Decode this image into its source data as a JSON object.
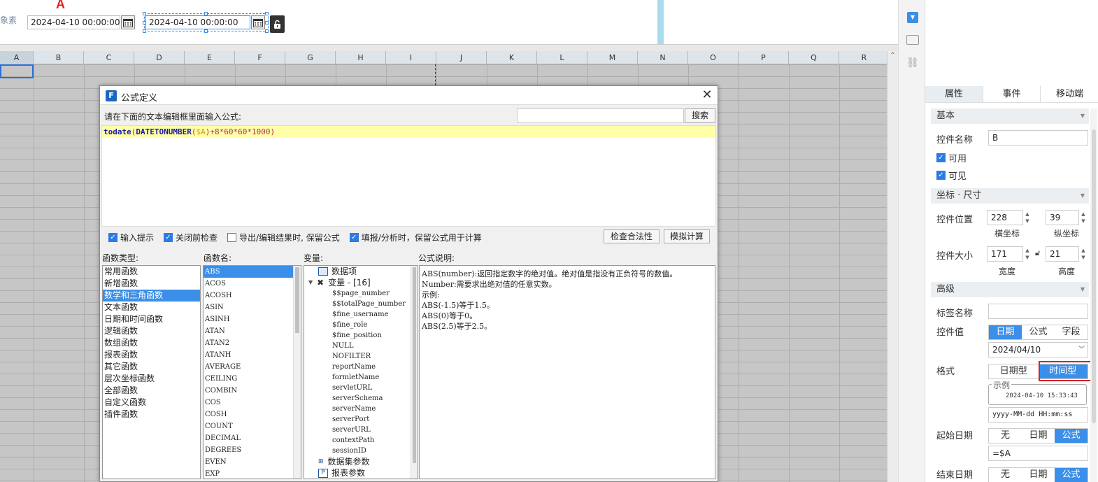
{
  "design": {
    "label_fragment": "象素",
    "marker_a": "A",
    "date_a": "2024-04-10 00:00:00",
    "date_b": "2024-04-10 00:00:00"
  },
  "sheet": {
    "columns": [
      "A",
      "B",
      "C",
      "D",
      "E",
      "F",
      "G",
      "H",
      "I",
      "J",
      "K",
      "L",
      "M",
      "N",
      "O",
      "P",
      "Q",
      "R"
    ]
  },
  "dialog": {
    "title": "公式定义",
    "prompt": "请在下面的文本编辑框里面输入公式:",
    "search_placeholder": "",
    "search_button": "搜索",
    "formula": {
      "fn1": "todate",
      "p1": "(",
      "fn2": "DATETONUMBER",
      "p2": "(",
      "var": "$A",
      "rest": ")+8*60*60*1000)"
    },
    "options": [
      {
        "label": "输入提示",
        "checked": true
      },
      {
        "label": "关闭前检查",
        "checked": true
      },
      {
        "label": "导出/编辑结果时, 保留公式",
        "checked": false
      },
      {
        "label": "填报/分析时，保留公式用于计算",
        "checked": true
      }
    ],
    "check_button": "检查合法性",
    "simulate_button": "模拟计算",
    "headers": {
      "types": "函数类型:",
      "names": "函数名:",
      "vars": "变量:",
      "desc": "公式说明:"
    },
    "types": [
      "常用函数",
      "新增函数",
      "数学和三角函数",
      "文本函数",
      "日期和时间函数",
      "逻辑函数",
      "数组函数",
      "报表函数",
      "其它函数",
      "层次坐标函数",
      "全部函数",
      "自定义函数",
      "插件函数"
    ],
    "selected_type_index": 2,
    "functions": [
      "ABS",
      "ACOS",
      "ACOSH",
      "ASIN",
      "ASINH",
      "ATAN",
      "ATAN2",
      "ATANH",
      "AVERAGE",
      "CEILING",
      "COMBIN",
      "COS",
      "COSH",
      "COUNT",
      "DECIMAL",
      "DEGREES",
      "EVEN",
      "EXP"
    ],
    "selected_function_index": 0,
    "tree": {
      "data_items": "数据项",
      "variables": "变量 - [16]",
      "variable_list": [
        "$$page_number",
        "$$totalPage_number",
        "$fine_username",
        "$fine_role",
        "$fine_position",
        "NULL",
        "NOFILTER",
        "reportName",
        "formletName",
        "servletURL",
        "serverSchema",
        "serverName",
        "serverPort",
        "serverURL",
        "contextPath",
        "sessionID"
      ],
      "dataset_params": "数据集参数",
      "report_params": "报表参数"
    },
    "description": [
      "ABS(number):返回指定数字的绝对值。绝对值是指没有正负符号的数值。",
      "Number:需要求出绝对值的任意实数。",
      "示例:",
      "ABS(-1.5)等于1.5。",
      "ABS(0)等于0。",
      "ABS(2.5)等于2.5。"
    ]
  },
  "panel": {
    "tabs": [
      "属性",
      "事件",
      "移动端"
    ],
    "basic": "基本",
    "name_label": "控件名称",
    "name_value": "B",
    "enabled": "可用",
    "visible": "可见",
    "geometry": "坐标 · 尺寸",
    "pos_label": "控件位置",
    "pos_x": "228",
    "pos_y": "39",
    "x_caption": "横坐标",
    "y_caption": "纵坐标",
    "size_label": "控件大小",
    "width": "171",
    "height": "21",
    "w_caption": "宽度",
    "h_caption": "高度",
    "advanced": "高级",
    "tag_label": "标签名称",
    "tag_value": "",
    "value_label": "控件值",
    "value_modes": [
      "日期",
      "公式",
      "字段"
    ],
    "value_date": "2024/04/10",
    "format_label": "格式",
    "format_modes": [
      "日期型",
      "时间型"
    ],
    "example_legend": "示例",
    "example_value": "2024-04-10 15:33:43",
    "pattern": "yyyy-MM-dd HH:mm:ss",
    "start_label": "起始日期",
    "start_modes": [
      "无",
      "日期",
      "公式"
    ],
    "start_value": "=$A",
    "end_label": "结束日期",
    "end_modes": [
      "无",
      "日期",
      "公式"
    ],
    "accent": "#3b8fe8",
    "highlight": "#e02020"
  }
}
